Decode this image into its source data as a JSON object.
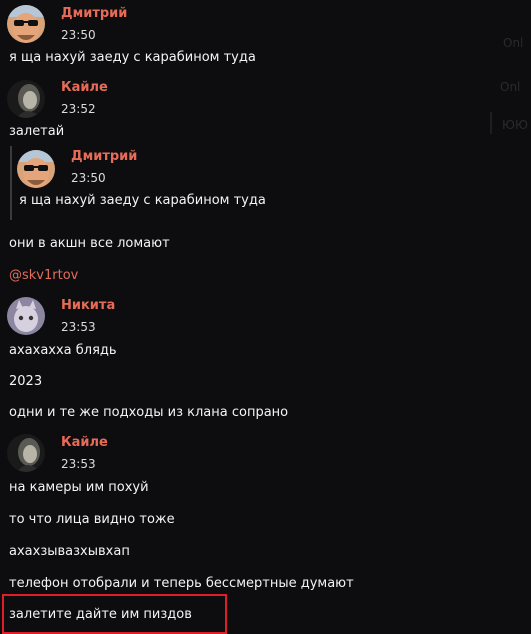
{
  "messages": [
    {
      "author": "Дмитрий",
      "time": "23:50",
      "text": "я ща нахуй заеду с карабином туда"
    },
    {
      "author": "Кайле",
      "time": "23:52",
      "text": "залетай"
    },
    {
      "quote": {
        "author": "Дмитрий",
        "time": "23:50",
        "text": "я ща нахуй заеду с карабином туда"
      }
    },
    {
      "text": "они в акшн все ломают"
    },
    {
      "mention": "@skv1rtov"
    },
    {
      "author": "Никита",
      "time": "23:53",
      "text": "ахахахха блядь"
    },
    {
      "text": "2023"
    },
    {
      "text": "одни и те же подходы из клана сопрано"
    },
    {
      "author": "Кайле",
      "time": "23:53",
      "text": "на камеры им похуй"
    },
    {
      "text": "то что лица видно тоже"
    },
    {
      "text": "ахахзывазхывхап"
    },
    {
      "text": "телефон отобрали и теперь бессмертные думают"
    },
    {
      "text": "залетите дайте им пиздов",
      "highlighted": true
    }
  ],
  "colors": {
    "author": "#e76b57",
    "mention": "#e46c5c",
    "highlight_border": "#e11d2a",
    "background": "#0d0d0f"
  },
  "background_ghost": {
    "line1": "Onl",
    "line2": "Onl",
    "line3": "ЮЮ"
  }
}
